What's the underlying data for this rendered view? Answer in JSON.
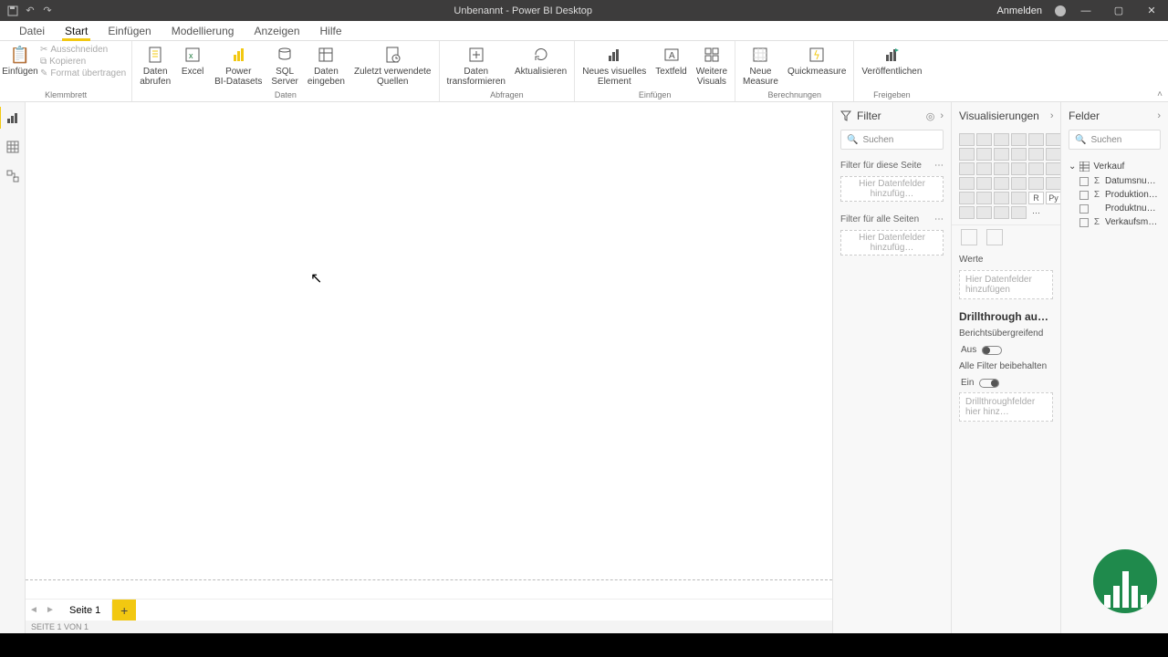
{
  "titlebar": {
    "title": "Unbenannt - Power BI Desktop",
    "signin": "Anmelden"
  },
  "tabs": [
    "Datei",
    "Start",
    "Einfügen",
    "Modellierung",
    "Anzeigen",
    "Hilfe"
  ],
  "active_tab": 1,
  "ribbon": {
    "clipboard": {
      "paste": "Einfügen",
      "cut": "Ausschneiden",
      "copy": "Kopieren",
      "format": "Format übertragen",
      "group": "Klemmbrett"
    },
    "data": {
      "get": "Daten\nabrufen",
      "excel": "Excel",
      "pbi": "Power\nBI-Datasets",
      "sql": "SQL\nServer",
      "enter": "Daten\neingeben",
      "recent": "Zuletzt verwendete\nQuellen",
      "group": "Daten"
    },
    "queries": {
      "transform": "Daten\ntransformieren",
      "refresh": "Aktualisieren",
      "group": "Abfragen"
    },
    "insert": {
      "visual": "Neues visuelles\nElement",
      "textbox": "Textfeld",
      "more": "Weitere\nVisuals",
      "group": "Einfügen"
    },
    "calc": {
      "measure": "Neue\nMeasure",
      "quick": "Quickmeasure",
      "group": "Berechnungen"
    },
    "share": {
      "publish": "Veröffentlichen",
      "group": "Freigeben"
    }
  },
  "filter": {
    "title": "Filter",
    "search": "Suchen",
    "page": "Filter für diese Seite",
    "all": "Filter für alle Seiten",
    "drop": "Hier Datenfelder hinzufüg…"
  },
  "viz": {
    "title": "Visualisierungen",
    "values": "Werte",
    "values_drop": "Hier Datenfelder hinzufügen",
    "drill_header": "Drillthrough ausfü…",
    "cross": "Berichtsübergreifend",
    "off": "Aus",
    "keep": "Alle Filter beibehalten",
    "on": "Ein",
    "drill_drop": "Drillthroughfelder hier hinz…"
  },
  "fields": {
    "title": "Felder",
    "search": "Suchen",
    "table": "Verkauf",
    "cols": [
      "Datumsnu…",
      "Produktion…",
      "Produktnu…",
      "Verkaufsme…"
    ]
  },
  "pages": {
    "page1": "Seite 1",
    "status": "SEITE 1 VON 1"
  }
}
